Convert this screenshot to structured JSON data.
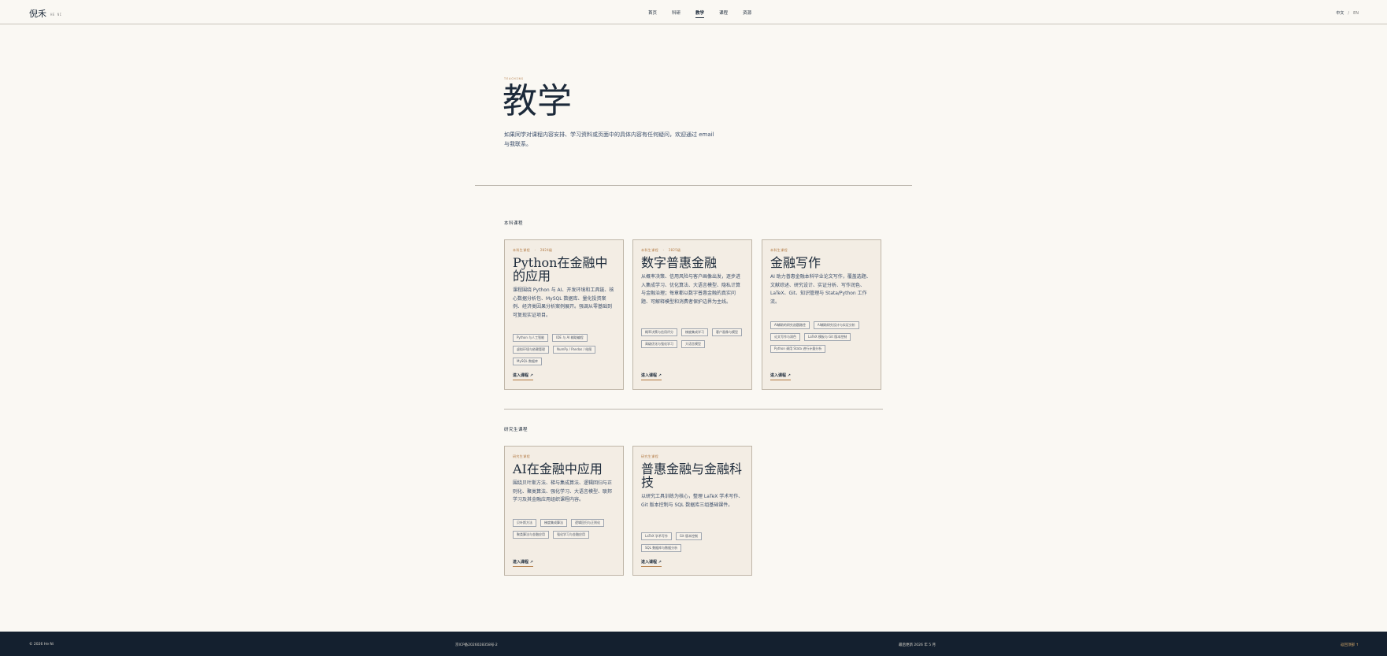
{
  "header": {
    "logo": "倪禾",
    "logo_sub": "HE NI",
    "nav": [
      "首页",
      "科研",
      "教学",
      "课程",
      "资源"
    ],
    "active_nav": "教学",
    "lang_current": "中文",
    "lang_sep": "/",
    "lang_alt": "EN"
  },
  "hero": {
    "eyebrow": "TEACHING",
    "title": "教学",
    "desc": "如果同学对课程内容安排、学习资料或页面中的具体内容有任何疑问，欢迎通过 email 与我联系。"
  },
  "undergrad": {
    "label": "本科课程",
    "cards": [
      {
        "meta_type": "本科生课程",
        "meta_year": "2024级",
        "title": "Python在金融中的应用",
        "desc": "课程围绕 Python 与 AI、开发环境和工具链、核心数据分析包、MySQL 数据库、量化投资案例、经济类因果分析案例展开。强调从零基础到可复现实证项目。",
        "tags": [
          "Python 与人工智能",
          "IDE 与 AI 辅助编程",
          "虚拟环境与依赖管理",
          "NumPy / Pandas / 绘图",
          "MySQL 数据库"
        ],
        "link": "进入课程"
      },
      {
        "meta_type": "本科生课程",
        "meta_year": "2025级",
        "title": "数字普惠金融",
        "desc": "从概率决策、信用风险与客户画像出发，逐步进入集成学习、优化算法、大语言模型、隐私计算与金融治理；每章都以数字普惠金融的真实问题、可解释模型和消费者保护边界为主线。",
        "tags": [
          "概率决策与信用评分",
          "梯度集成学习",
          "客户画像与模型",
          "高级优化与强化学习",
          "大语言模型"
        ],
        "link": "进入课程"
      },
      {
        "meta_type": "本科生课程",
        "meta_year": "",
        "title": "金融写作",
        "desc": "AI 助力普惠金融本科毕业论文写作，覆盖选题、文献综述、研究设计、实证分析、写作润色、LaTeX、Git、知识管理与 Stata/Python 工作流。",
        "tags": [
          "AI辅助的研究选题路径",
          "AI辅助研究设计与实证分析",
          "论文写作与润色",
          "LaTeX 模板与 Git 版本控制",
          "Python 调用 Stata 进行计量分析"
        ],
        "link": "进入课程"
      }
    ]
  },
  "grad": {
    "label": "研究生课程",
    "cards": [
      {
        "meta_type": "研究生课程",
        "meta_year": "",
        "title": "AI在金融中应用",
        "desc": "围绕贝叶斯方法、梯与集成算法、逻辑回归与正则化、聚类算法、强化学习、大语言模型、联邦学习及其金融应用组织课程内容。",
        "tags": [
          "贝叶斯方法",
          "梯度集成算法",
          "逻辑回归与正则化",
          "聚类算法与金融应用",
          "强化学习与金融应用"
        ],
        "link": "进入课程"
      },
      {
        "meta_type": "研究生课程",
        "meta_year": "",
        "title": "普惠金融与金融科技",
        "desc": "以研究工具训练为核心，整理 LaTeX 学术写作、Git 版本控制与 SQL 数据库三组基础课件。",
        "tags": [
          "LaTeX 学术写作",
          "Git 版本控制",
          "SQL 数据库与数据分析"
        ],
        "link": "进入课程"
      }
    ]
  },
  "footer": {
    "copyright": "© 2026 He Ni",
    "icp": "京ICP备2026028358号-2",
    "updated": "最后更新  2026 年 5 月",
    "back": "返回顶部 ↑"
  },
  "icons": {
    "link_arrow": "arrow-up-right-icon"
  }
}
